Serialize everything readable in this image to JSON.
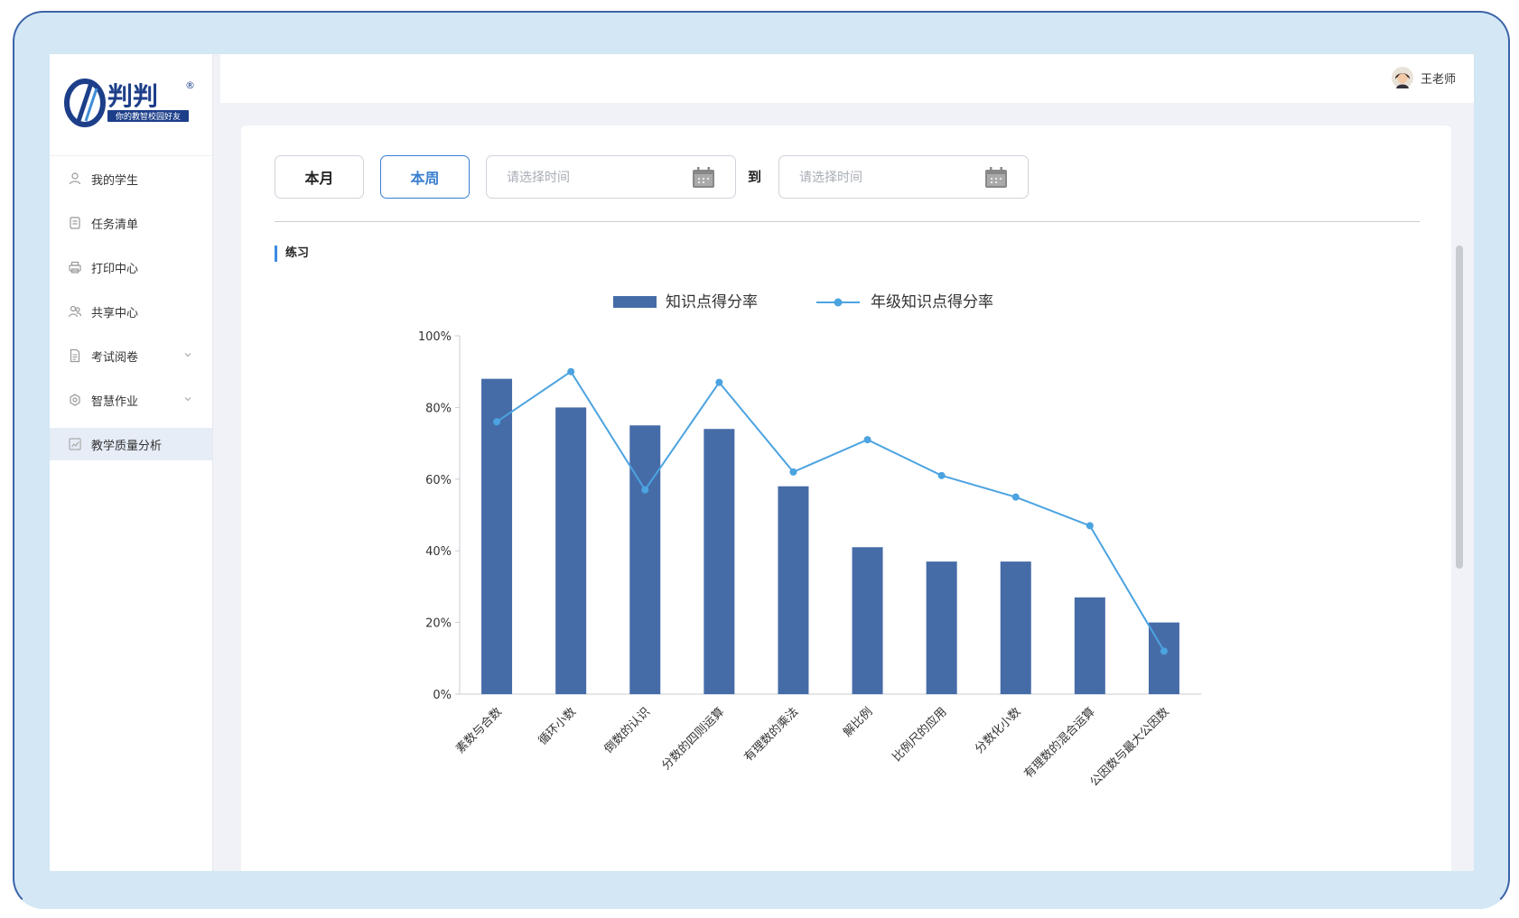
{
  "brand": {
    "logo_text": "判判",
    "logo_tagline": "你的教智校园好友",
    "registered_mark": "®"
  },
  "sidebar": {
    "items": [
      {
        "label": "我的学生",
        "icon": "user-icon"
      },
      {
        "label": "任务清单",
        "icon": "clipboard-icon"
      },
      {
        "label": "打印中心",
        "icon": "printer-icon"
      },
      {
        "label": "共享中心",
        "icon": "share-users-icon"
      },
      {
        "label": "考试阅卷",
        "icon": "document-icon",
        "expandable": true
      },
      {
        "label": "智慧作业",
        "icon": "lightbulb-icon",
        "expandable": true
      },
      {
        "label": "教学质量分析",
        "icon": "chart-icon",
        "active": true
      }
    ]
  },
  "header": {
    "user_name": "王老师"
  },
  "filters": {
    "month_label": "本月",
    "week_label": "本周",
    "active": "本周",
    "start_placeholder": "请选择时间",
    "to_label": "到",
    "end_placeholder": "请选择时间"
  },
  "section": {
    "title": "练习"
  },
  "colors": {
    "bar": "#466ca8",
    "line": "#4ba3e0",
    "accent": "#3a7fd0"
  },
  "chart_data": {
    "type": "bar",
    "categories": [
      "素数与合数",
      "循环小数",
      "倒数的认识",
      "分数的四则运算",
      "有理数的乘法",
      "解比例",
      "比例尺的应用",
      "分数化小数",
      "有理数的混合运算",
      "公因数与最大公因数"
    ],
    "series": [
      {
        "name": "知识点得分率",
        "type": "bar",
        "values": [
          88,
          80,
          75,
          74,
          58,
          41,
          37,
          37,
          27,
          20
        ]
      },
      {
        "name": "年级知识点得分率",
        "type": "line",
        "values": [
          76,
          90,
          57,
          87,
          62,
          71,
          61,
          55,
          47,
          12
        ]
      }
    ],
    "ylim": [
      0,
      100
    ],
    "yticks": [
      "0%",
      "20%",
      "40%",
      "60%",
      "80%",
      "100%"
    ],
    "legend_position": "top-center",
    "grid": false
  }
}
